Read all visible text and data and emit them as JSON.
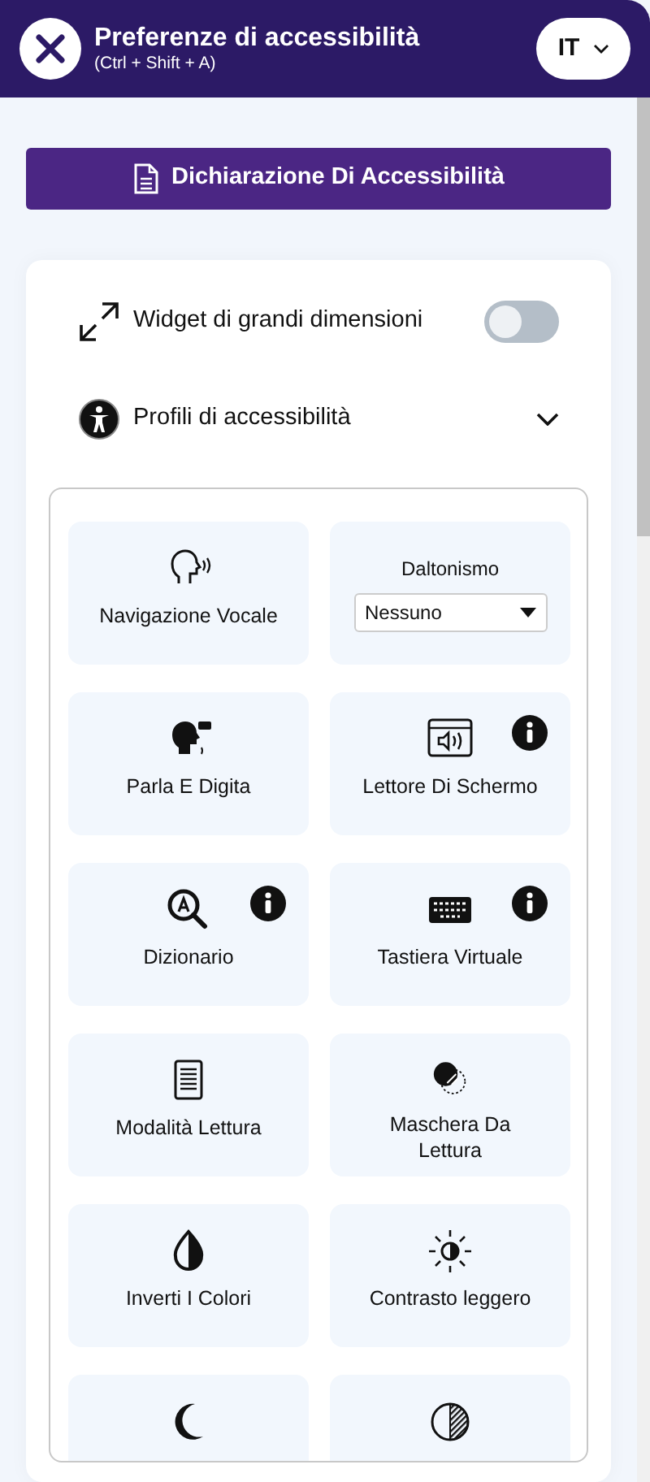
{
  "header": {
    "title": "Preferenze di accessibilità",
    "shortcut": "(Ctrl + Shift + A)",
    "language": "IT"
  },
  "statement_button": "Dichiarazione Di Accessibilità",
  "large_widget": {
    "label": "Widget di grandi dimensioni",
    "on": false
  },
  "profiles": {
    "label": "Profili di accessibilità",
    "expanded": false
  },
  "tiles": [
    {
      "kind": "feature",
      "label": "Navigazione Vocale",
      "info": false
    },
    {
      "kind": "select",
      "label": "Daltonismo",
      "value": "Nessuno"
    },
    {
      "kind": "feature",
      "label": "Parla E Digita",
      "info": false
    },
    {
      "kind": "feature",
      "label": "Lettore Di Schermo",
      "info": true
    },
    {
      "kind": "feature",
      "label": "Dizionario",
      "info": true
    },
    {
      "kind": "feature",
      "label": "Tastiera Virtuale",
      "info": true
    },
    {
      "kind": "feature",
      "label": "Modalità Lettura",
      "info": false
    },
    {
      "kind": "feature",
      "label": "Maschera Da Lettura",
      "info": false
    },
    {
      "kind": "feature",
      "label": "Inverti I Colori",
      "info": false
    },
    {
      "kind": "feature",
      "label": "Contrasto leggero",
      "info": false
    },
    {
      "kind": "feature",
      "info": false
    },
    {
      "kind": "feature",
      "info": false
    }
  ]
}
